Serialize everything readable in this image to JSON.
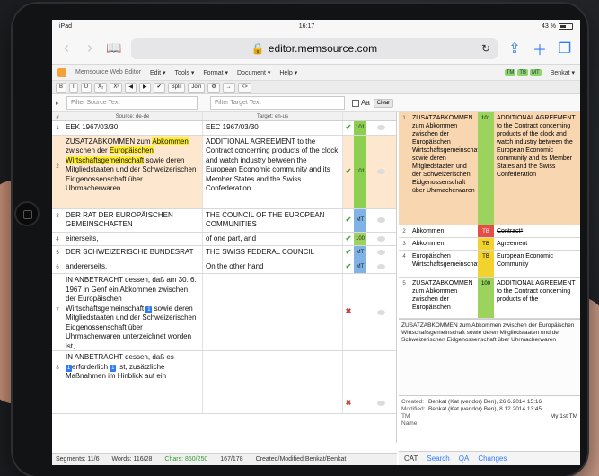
{
  "status_bar": {
    "carrier": "iPad",
    "time": "16:17",
    "battery": "43 %"
  },
  "browser": {
    "url": "editor.memsource.com"
  },
  "app": {
    "name": "Memsource Web Editor",
    "menus": [
      "Edit ▾",
      "Tools ▾",
      "Format ▾",
      "Document ▾",
      "Help ▾"
    ],
    "modes": [
      "TM",
      "TB",
      "MT"
    ],
    "user": "Benkat ▾"
  },
  "format_toolbar": [
    "B",
    "I",
    "U",
    "X₂",
    "X²",
    "◀",
    "▶",
    "✔",
    "Split",
    "Join",
    "⚙",
    "→",
    "<>"
  ],
  "filters": {
    "source_placeholder": "Filter Source Text",
    "target_placeholder": "Filter Target Text",
    "aa_label": "Aa",
    "clear_label": "Clear"
  },
  "grid": {
    "header": {
      "num": "#",
      "source": "Source: de-de",
      "target": "Target: en-us"
    },
    "rows": [
      {
        "num": "1",
        "source": "EEK 1967/03/30",
        "target": "EEC 1967/03/30",
        "status": "✔",
        "score": "101"
      },
      {
        "num": "2",
        "source_pre": "ZUSATZABKOMMEN zum ",
        "source_hl1": "Abkommen",
        "source_mid": " zwischen der ",
        "source_hl2": "Europäischen Wirtschaftsgemeinschaft",
        "source_post": " sowie deren Mitgliedstaaten und der Schweizerischen Eidgenossenschaft über Uhrmacherwaren",
        "target": "ADDITIONAL AGREEMENT to the Contract concerning products of the clock and watch industry between the European Economic community and its Member States and the Swiss Confederation",
        "status": "✔",
        "score": "101"
      },
      {
        "num": "3",
        "source": "DER RAT DER EUROPÄISCHEN GEMEINSCHAFTEN",
        "target": "THE COUNCIL OF THE EUROPEAN COMMUNITIES",
        "status": "✔",
        "score": "MT"
      },
      {
        "num": "4",
        "source": "einerseits,",
        "target": "of one part, and",
        "status": "✔",
        "score": "100"
      },
      {
        "num": "5",
        "source": "DER SCHWEIZERISCHE BUNDESRAT",
        "target": "THE SWISS FEDERAL COUNCIL",
        "status": "✔",
        "score": "MT"
      },
      {
        "num": "6",
        "source": "andererseits,",
        "target": "On the other hand",
        "status": "✔",
        "score": "MT"
      },
      {
        "num": "7",
        "source_pre": "IN ANBETRACHT dessen, daß am 30. 6. 1967 in Genf ein Abkommen zwischen der Europäischen Wirtschaftsgemeinschaft ",
        "tag": "1",
        "source_post": " sowie deren Mitgliedstaaten und der Schweizerischen Eidgenossenschaft über Uhrmacherwaren unterzeichnet worden ist,",
        "target": "",
        "status": "✖",
        "score": ""
      },
      {
        "num": "8",
        "source_pre": "IN ANBETRACHT dessen, daß es ",
        "tag": "1",
        "source_mid": "erforderlich ",
        "tag2": "1",
        "source_post": " ist, zusätzliche Maßnahmen im Hinblick auf ein",
        "target": "",
        "status": "✖",
        "score": ""
      }
    ]
  },
  "footer": {
    "segments": "Segments: 11/6",
    "words": "Words: 116/28",
    "chars": "Chars: 850/250",
    "progress": "167/178",
    "created": "Created/Modified:Benkat/Benkat"
  },
  "panel": {
    "matches": [
      {
        "num": "1",
        "source": "ZUSATZABKOMMEN zum Abkommen zwischen der Europäischen Wirtschaftsgemeinschaft sowie deren Mitgliedstaaten und der Schweizerischen Eidgenossenschaft über Uhrmacherwaren",
        "score": "101",
        "target": "ADDITIONAL AGREEMENT to the Contract concerning products of the clock and watch industry between the European Economic community and its Member States and the Swiss Confederation"
      },
      {
        "num": "2",
        "source": "Abkommen",
        "score": "TB",
        "target": "Contract*"
      },
      {
        "num": "3",
        "source": "Abkommen",
        "score": "TB",
        "target": "Agreement"
      },
      {
        "num": "4",
        "source": "Europäischen Wirtschaftsgemeinschaft",
        "score": "TB",
        "target": "European Economic Community"
      },
      {
        "num": "5",
        "source": "ZUSATZABKOMMEN zum Abkommen zwischen der Europäischen",
        "score": "100",
        "target": "ADDITIONAL AGREEMENT to the Contract concerning products of the"
      }
    ],
    "context": "ZUSATZABKOMMEN zum Abkommen zwischen der Europäischen Wirtschaftsgemeinschaft sowie deren Mitgliedstaaten und der Schweizerischen Eidgenossenschaft über Uhrmacherwaren",
    "meta": {
      "created_label": "Created:",
      "created": "Benkat (Kat (vendor) Ben), 26.6.2014 15:16",
      "modified_label": "Modified:",
      "modified": "Benkat (Kat (vendor) Ben), 8.12.2014 13:45",
      "tmname_label": "TM Name:",
      "tmname": "My 1st TM"
    },
    "tabs": [
      "CAT",
      "Search",
      "QA",
      "Changes"
    ]
  }
}
